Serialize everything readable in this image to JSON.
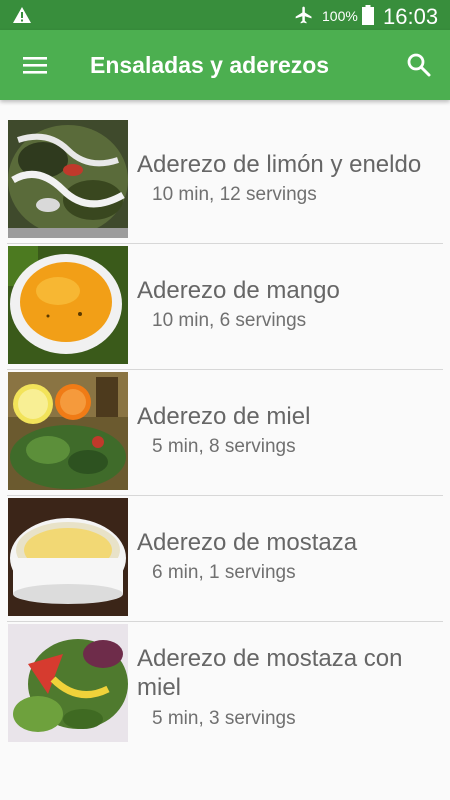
{
  "status_bar": {
    "battery": "100%",
    "time": "16:03",
    "icons": [
      "warning-icon",
      "airplane-mode-icon",
      "battery-icon"
    ]
  },
  "toolbar": {
    "title": "Ensaladas y aderezos",
    "menu_icon": "hamburger-menu-icon",
    "search_icon": "search-icon",
    "color": "#4caf50",
    "status_color": "#388e3c"
  },
  "recipes": [
    {
      "name": "Aderezo de limón y eneldo",
      "meta": "10 min, 12 servings"
    },
    {
      "name": "Aderezo de mango",
      "meta": "10 min, 6 servings"
    },
    {
      "name": "Aderezo de miel",
      "meta": "5 min, 8 servings"
    },
    {
      "name": "Aderezo de mostaza",
      "meta": "6 min, 1 servings"
    },
    {
      "name": "Aderezo de mostaza con miel",
      "meta": "5 min, 3 servings"
    }
  ]
}
